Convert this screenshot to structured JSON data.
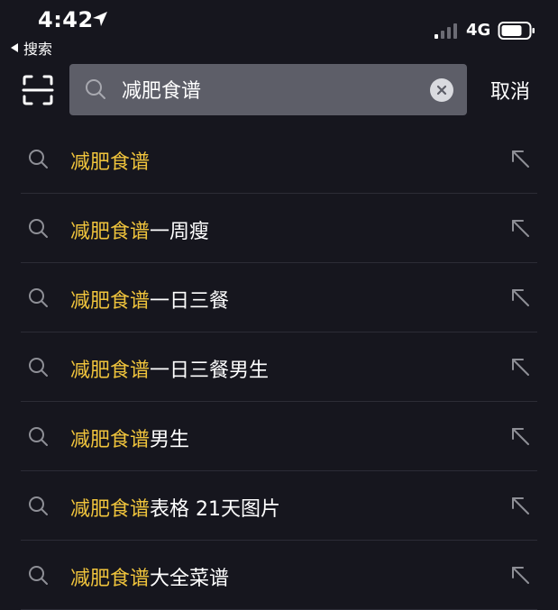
{
  "status_bar": {
    "time": "4:42",
    "back_label": "搜索",
    "network": "4G"
  },
  "search": {
    "query": "减肥食谱",
    "cancel_label": "取消"
  },
  "suggestions": [
    {
      "highlight": "减肥食谱",
      "rest": ""
    },
    {
      "highlight": "减肥食谱",
      "rest": "一周瘦"
    },
    {
      "highlight": "减肥食谱",
      "rest": "一日三餐"
    },
    {
      "highlight": "减肥食谱",
      "rest": "一日三餐男生"
    },
    {
      "highlight": "减肥食谱",
      "rest": "男生"
    },
    {
      "highlight": "减肥食谱",
      "rest": "表格 21天图片"
    },
    {
      "highlight": "减肥食谱",
      "rest": "大全菜谱"
    }
  ],
  "colors": {
    "background": "#16161e",
    "search_box": "#5d5e68",
    "highlight": "#f0c43c",
    "divider": "#2c2c36"
  },
  "icons": {
    "scan": "scan-icon",
    "search": "search-icon",
    "clear": "clear-icon",
    "fill_suggestion": "arrow-up-left-icon",
    "location": "location-arrow-icon",
    "signal": "signal-icon",
    "battery": "battery-icon"
  }
}
